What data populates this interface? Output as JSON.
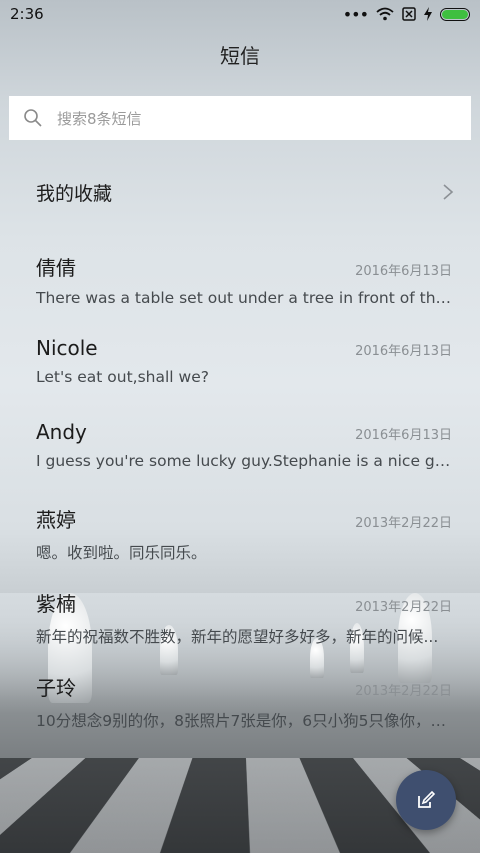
{
  "status_bar": {
    "time": "2:36",
    "icons": [
      "dots-icon",
      "wifi-icon",
      "no-sim-icon",
      "charging-icon",
      "battery-icon"
    ],
    "battery_color": "#3fbf3f"
  },
  "header": {
    "title": "短信"
  },
  "search": {
    "placeholder": "搜索8条短信"
  },
  "favorites": {
    "label": "我的收藏"
  },
  "messages": [
    {
      "name": "倩倩",
      "date": "2016年6月13日",
      "snippet": "There was a table set out under a tree in front of the ho..."
    },
    {
      "name": "Nicole",
      "date": "2016年6月13日",
      "snippet": "Let's eat out,shall we?"
    },
    {
      "name": "Andy",
      "date": "2016年6月13日",
      "snippet": "I guess you're some lucky guy.Stephanie is a nice girl."
    },
    {
      "name": "燕婷",
      "date": "2013年2月22日",
      "snippet": "嗯。收到啦。同乐同乐。"
    },
    {
      "name": "紫楠",
      "date": "2013年2月22日",
      "snippet": "新年的祝福数不胜数，新年的愿望好多好多，新年的问候..."
    },
    {
      "name": "子玲",
      "date": "2013年2月22日",
      "snippet": "10分想念9别的你，8张照片7张是你，6只小狗5只像你，4..."
    }
  ],
  "fab": {
    "icon": "compose-icon",
    "color": "#3f4f6f"
  }
}
